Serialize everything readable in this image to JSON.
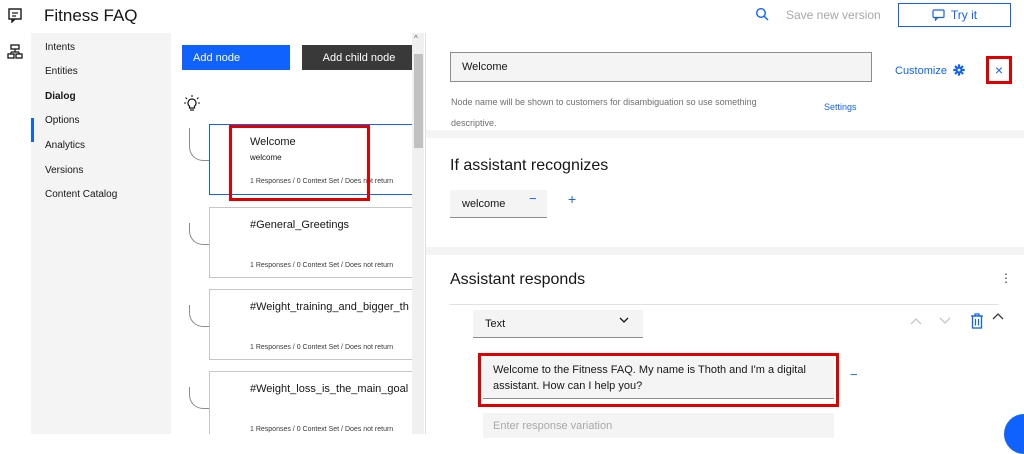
{
  "app": {
    "title": "Fitness FAQ"
  },
  "header": {
    "search_icon": "search-icon",
    "save_label": "Save new version",
    "try_label": "Try it"
  },
  "nav": {
    "items": [
      {
        "label": "Intents"
      },
      {
        "label": "Entities"
      },
      {
        "label": "Dialog",
        "active": true
      },
      {
        "label": "Options"
      },
      {
        "label": "Analytics"
      },
      {
        "label": "Versions"
      },
      {
        "label": "Content Catalog"
      }
    ]
  },
  "tree": {
    "add_node_label": "Add node",
    "add_child_label": "Add child node",
    "nodes": [
      {
        "title": "Welcome",
        "condition": "welcome",
        "meta": "1 Responses / 0 Context Set / Does not return"
      },
      {
        "title": "#General_Greetings",
        "condition": "",
        "meta": "1 Responses / 0 Context Set / Does not return"
      },
      {
        "title": "#Weight_training_and_bigger_th",
        "condition": "",
        "meta": "1 Responses / 0 Context Set / Does not return"
      },
      {
        "title": "#Weight_loss_is_the_main_goal",
        "condition": "",
        "meta": "1 Responses / 0 Context Set / Does not return"
      }
    ]
  },
  "editor": {
    "node_name": "Welcome",
    "helper_text": "Node name will be shown to customers for disambiguation so use something descriptive.",
    "settings_label": "Settings",
    "customize_label": "Customize",
    "close_label": "×",
    "recognizes_title": "If assistant recognizes",
    "condition_chip": "welcome",
    "minus_label": "−",
    "plus_label": "+",
    "responds_title": "Assistant responds",
    "kebab_label": "⋮",
    "response_type": "Text",
    "response_text": "Welcome to the Fitness FAQ. My name is Thoth and I'm a digital assistant. How can I help you?",
    "variation_placeholder": "Enter response variation"
  },
  "colors": {
    "accent": "#0f62fe",
    "highlight": "#e00000",
    "dark_button": "#393939"
  }
}
